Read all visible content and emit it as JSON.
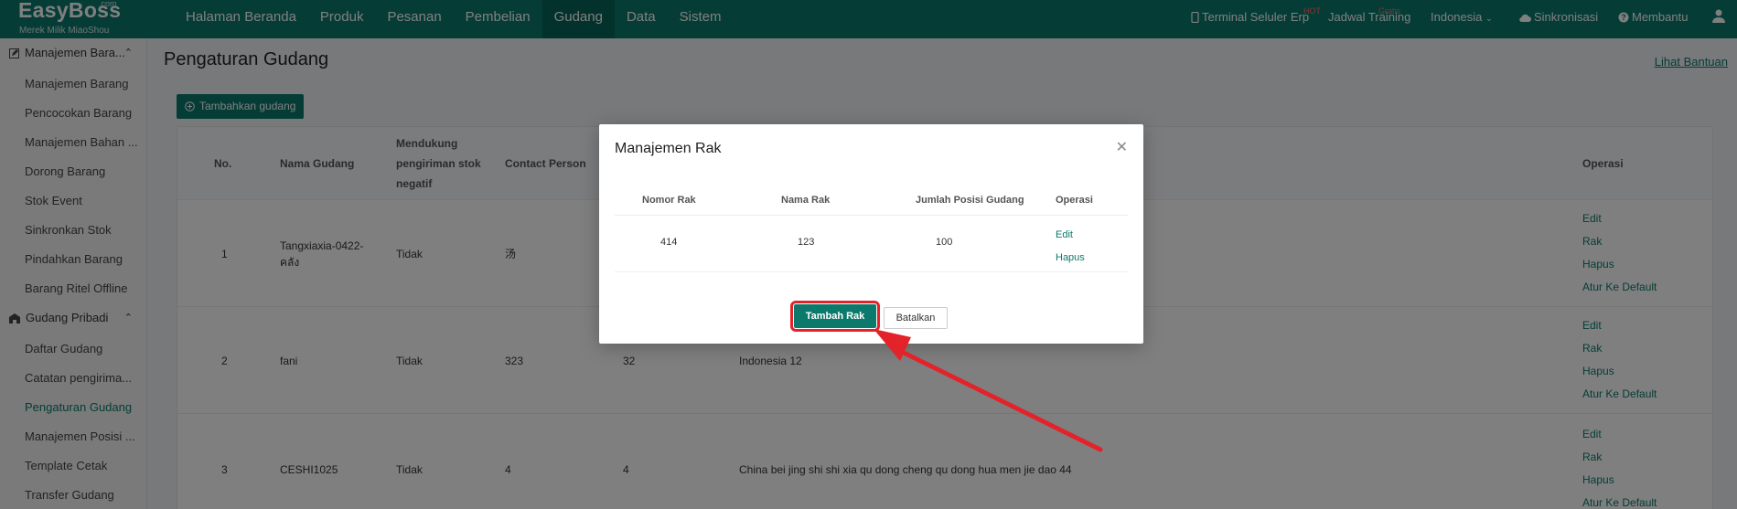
{
  "topbar": {
    "logo_text": "EasyBoss",
    "logo_com": ".com",
    "logo_sub": "Merek Milik MiaoShou",
    "nav": [
      "Halaman Beranda",
      "Produk",
      "Pesanan",
      "Pembelian",
      "Gudang",
      "Data",
      "Sistem"
    ],
    "active_nav": "Gudang",
    "terminal": "Terminal Seluler Erp",
    "terminal_badge": "HOT",
    "training": "Jadwal Training",
    "training_badge": "Gratis",
    "language": "Indonesia",
    "sync": "Sinkronisasi",
    "help": "Membantu"
  },
  "sidebar": {
    "group1": "Manajemen Bara...",
    "items1": [
      "Manajemen Barang",
      "Pencocokan Barang",
      "Manajemen Bahan ...",
      "Dorong Barang",
      "Stok Event",
      "Sinkronkan Stok",
      "Pindahkan Barang",
      "Barang Ritel Offline"
    ],
    "group2": "Gudang Pribadi",
    "items2": [
      "Daftar Gudang",
      "Catatan pengirima...",
      "Pengaturan Gudang",
      "Manajemen Posisi ...",
      "Template Cetak",
      "Transfer Gudang"
    ],
    "active_item": "Pengaturan Gudang"
  },
  "main": {
    "title": "Pengaturan Gudang",
    "help_link": "Lihat Bantuan",
    "add_button": "Tambahkan gudang",
    "headers": {
      "no": "No.",
      "name": "Nama Gudang",
      "negative": "Mendukung pengiriman stok negatif",
      "contact": "Contact Person",
      "ops": "Operasi"
    },
    "rows": [
      {
        "no": "1",
        "name": "Tangxiaxia-0422-คลัง",
        "negative": "Tidak",
        "contact": "汤",
        "phone": "",
        "address": ""
      },
      {
        "no": "2",
        "name": "fani",
        "negative": "Tidak",
        "contact": "323",
        "phone": "32",
        "address": "Indonesia 12"
      },
      {
        "no": "3",
        "name": "CESHI1025",
        "negative": "Tidak",
        "contact": "4",
        "phone": "4",
        "address": "China bei jing shi shi xia qu dong cheng qu dong hua men jie dao 44"
      }
    ],
    "row_ops": [
      "Edit",
      "Rak",
      "Hapus",
      "Atur Ke Default"
    ]
  },
  "modal": {
    "title": "Manajemen Rak",
    "headers": {
      "rack_no": "Nomor Rak",
      "rack_name": "Nama Rak",
      "positions": "Jumlah Posisi Gudang",
      "ops": "Operasi"
    },
    "row": {
      "rack_no": "414",
      "rack_name": "123",
      "positions": "100",
      "edit": "Edit",
      "delete": "Hapus"
    },
    "add_rack": "Tambah Rak",
    "cancel": "Batalkan"
  },
  "colors": {
    "primary": "#0b7a6c",
    "highlight": "#e3232a"
  }
}
